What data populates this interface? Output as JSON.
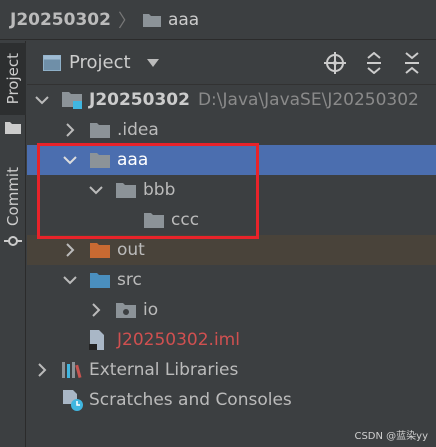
{
  "breadcrumb": {
    "project": "J20250302",
    "folder": "aaa"
  },
  "side_tabs": {
    "project": "Project",
    "commit": "Commit"
  },
  "toolbar": {
    "title": "Project"
  },
  "tree": {
    "root": {
      "name": "J20250302",
      "path": "D:\\Java\\JavaSE\\J20250302"
    },
    "idea": ".idea",
    "aaa": "aaa",
    "bbb": "bbb",
    "ccc": "ccc",
    "out": "out",
    "src": "src",
    "io": "io",
    "iml": "J20250302.iml",
    "ext": "External Libraries",
    "scratch": "Scratches and Consoles"
  },
  "watermark": "CSDN @蓝染yy",
  "colors": {
    "selection": "#4b6eaf",
    "highlight_box": "#e8232a",
    "iml_text": "#d05050",
    "excluded_bg": "#49433a"
  }
}
